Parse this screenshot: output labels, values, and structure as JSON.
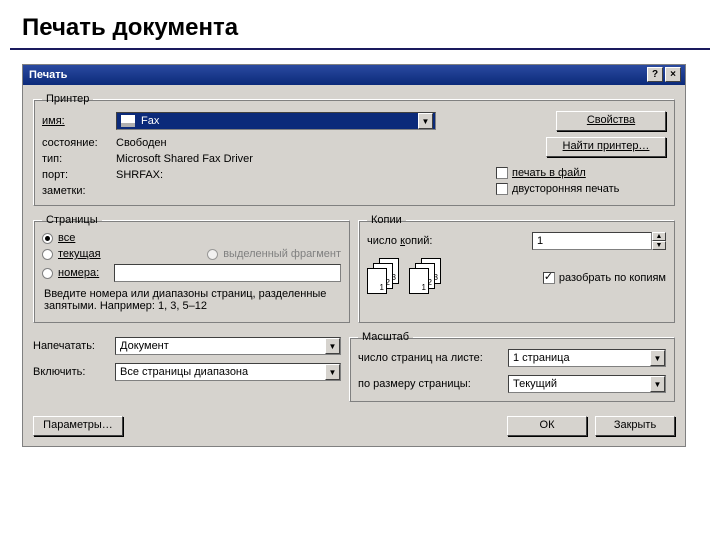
{
  "slide": {
    "title": "Печать документа"
  },
  "dialog": {
    "title": "Печать"
  },
  "printer": {
    "legend": "Принтер",
    "name_label": "имя:",
    "name_value": "Fax",
    "state_label": "состояние:",
    "state_value": "Свободен",
    "type_label": "тип:",
    "type_value": "Microsoft Shared Fax Driver",
    "port_label": "порт:",
    "port_value": "SHRFAX:",
    "notes_label": "заметки:",
    "properties_btn": "Свойства",
    "find_btn": "Найти принтер…",
    "print_to_file": "печать в файл",
    "duplex": "двусторонняя печать"
  },
  "pages": {
    "legend": "Страницы",
    "all": "все",
    "current": "текущая",
    "selection": "выделенный фрагмент",
    "numbers": "номера:",
    "hint": "Введите номера или диапазоны страниц, разделенные запятыми. Например: 1, 3, 5–12"
  },
  "copies": {
    "legend": "Копии",
    "count_label": "число копий:",
    "count_value": "1",
    "collate": "разобрать по копиям",
    "p1": "1",
    "p2": "2",
    "p3": "3"
  },
  "print_what": {
    "print_label": "Напечатать:",
    "print_value": "Документ",
    "include_label": "Включить:",
    "include_value": "Все страницы диапазона"
  },
  "scale": {
    "legend": "Масштаб",
    "per_sheet_label": "число страниц на листе:",
    "per_sheet_value": "1 страница",
    "fit_label": "по размеру страницы:",
    "fit_value": "Текущий"
  },
  "footer": {
    "options": "Параметры…",
    "ok": "ОК",
    "close": "Закрыть"
  }
}
